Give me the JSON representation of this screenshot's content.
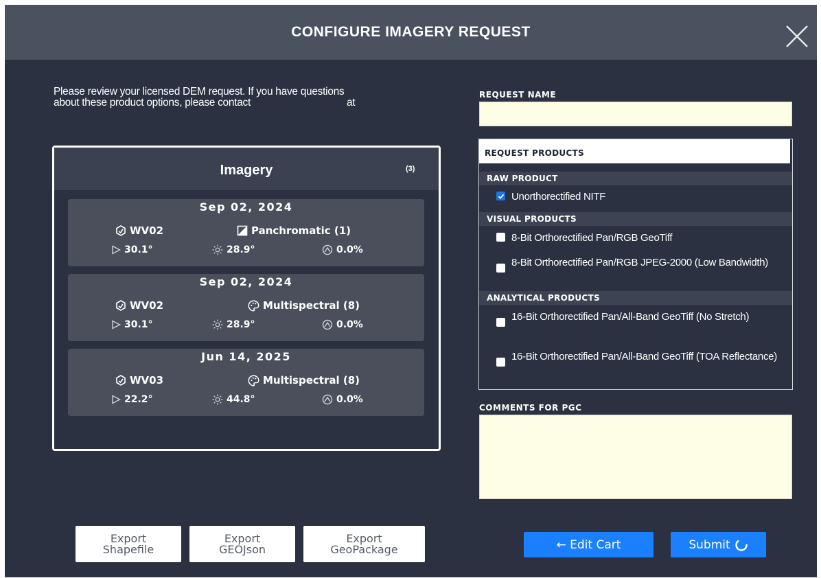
{
  "header": {
    "title": "CONFIGURE IMAGERY REQUEST"
  },
  "intro": {
    "line1": "Please review your licensed DEM request. If you have questions",
    "line2_start": "about these product options, please contact",
    "line2_end": "at"
  },
  "imagery": {
    "title": "Imagery",
    "count": "(3)",
    "cards": [
      {
        "date": "Sep 02, 2024",
        "satellite": "WV02",
        "band": "Panchromatic (1)",
        "band_icon": "panchromatic-icon",
        "off_nadir": "30.1°",
        "sun_elevation": "28.9°",
        "cloud_cover": "0.0%"
      },
      {
        "date": "Sep 02, 2024",
        "satellite": "WV02",
        "band": "Multispectral (8)",
        "band_icon": "palette-icon",
        "off_nadir": "30.1°",
        "sun_elevation": "28.9°",
        "cloud_cover": "0.0%"
      },
      {
        "date": "Jun 14, 2025",
        "satellite": "WV03",
        "band": "Multispectral (8)",
        "band_icon": "palette-icon",
        "off_nadir": "22.2°",
        "sun_elevation": "44.8°",
        "cloud_cover": "0.0%"
      }
    ]
  },
  "request_name": {
    "label": "REQUEST NAME",
    "value": ""
  },
  "products": {
    "label": "REQUEST PRODUCTS",
    "groups": [
      {
        "title": "RAW PRODUCT",
        "options": [
          {
            "label": "Unorthorectified NITF",
            "checked": true
          }
        ]
      },
      {
        "title": "VISUAL PRODUCTS",
        "options": [
          {
            "label": "8-Bit Orthorectified Pan/RGB GeoTiff",
            "checked": false
          },
          {
            "label": "8-Bit Orthorectified Pan/RGB JPEG-2000 (Low Bandwidth)",
            "checked": false
          }
        ]
      },
      {
        "title": "ANALYTICAL PRODUCTS",
        "options": [
          {
            "label": "16-Bit Orthorectified Pan/All-Band GeoTiff (No Stretch)",
            "checked": false
          },
          {
            "label": "16-Bit Orthorectified Pan/All-Band GeoTiff (TOA Reflectance)",
            "checked": false
          }
        ]
      }
    ]
  },
  "comments": {
    "label": "COMMENTS FOR PGC",
    "value": ""
  },
  "buttons": {
    "export_shapefile": [
      "Export",
      "Shapefile"
    ],
    "export_geojson": [
      "Export",
      "GEOJson"
    ],
    "export_geopackage": [
      "Export",
      "GeoPackage"
    ],
    "edit_cart": "← Edit Cart",
    "submit": "Submit"
  },
  "colors": {
    "background": "#2b3140",
    "header": "#4a515f",
    "card": "#4a4f5b",
    "primary_button": "#1a80ff",
    "input_background": "#fefde6",
    "checkbox_checked": "#1a73e8"
  }
}
